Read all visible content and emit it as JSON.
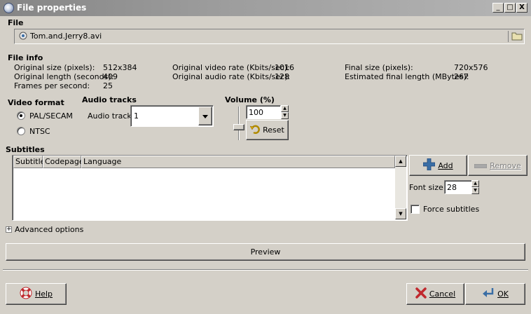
{
  "window": {
    "title": "File properties",
    "minimize_glyph": "_",
    "maximize_glyph": "□",
    "close_glyph": "X"
  },
  "file": {
    "section_label": "File",
    "filename": "Tom.and.Jerry8.avi"
  },
  "file_info": {
    "section_label": "File info",
    "original_size_label": "Original size (pixels):",
    "original_size_value": "512x384",
    "original_length_label": "Original length (seconds):",
    "original_length_value": "409",
    "fps_label": "Frames per second:",
    "fps_value": "25",
    "video_rate_label": "Original video rate (Kbits/sec):",
    "video_rate_value": "1016",
    "audio_rate_label": "Original audio rate (Kbits/sec):",
    "audio_rate_value": "128",
    "final_size_label": "Final size (pixels):",
    "final_size_value": "720x576",
    "final_length_label": "Estimated final length (MBytes):",
    "final_length_value": "267"
  },
  "video_format": {
    "section_label": "Video format",
    "options": [
      "PAL/SECAM",
      "NTSC"
    ],
    "selected": "PAL/SECAM"
  },
  "audio_tracks": {
    "section_label": "Audio tracks",
    "track_label": "Audio track:",
    "track_value": "1"
  },
  "volume": {
    "section_label": "Volume (%)",
    "value": "100",
    "reset_label": "Reset"
  },
  "subtitles": {
    "section_label": "Subtitles",
    "columns": [
      "Subtitle",
      "Codepage",
      "Language"
    ],
    "add_label": "Add",
    "remove_label": "Remove",
    "font_size_label": "Font size:",
    "font_size_value": "28",
    "force_label": "Force subtitles"
  },
  "advanced": {
    "expander_glyph": "+",
    "label": "Advanced options"
  },
  "preview_label": "Preview",
  "footer": {
    "help_label": "Help",
    "cancel_label": "Cancel",
    "ok_label": "OK"
  },
  "colors": {
    "face": "#d4d0c8",
    "titlebar": "#9c9c9c",
    "add_icon": "#3a6ea5",
    "cancel_icon": "#c0282d"
  }
}
